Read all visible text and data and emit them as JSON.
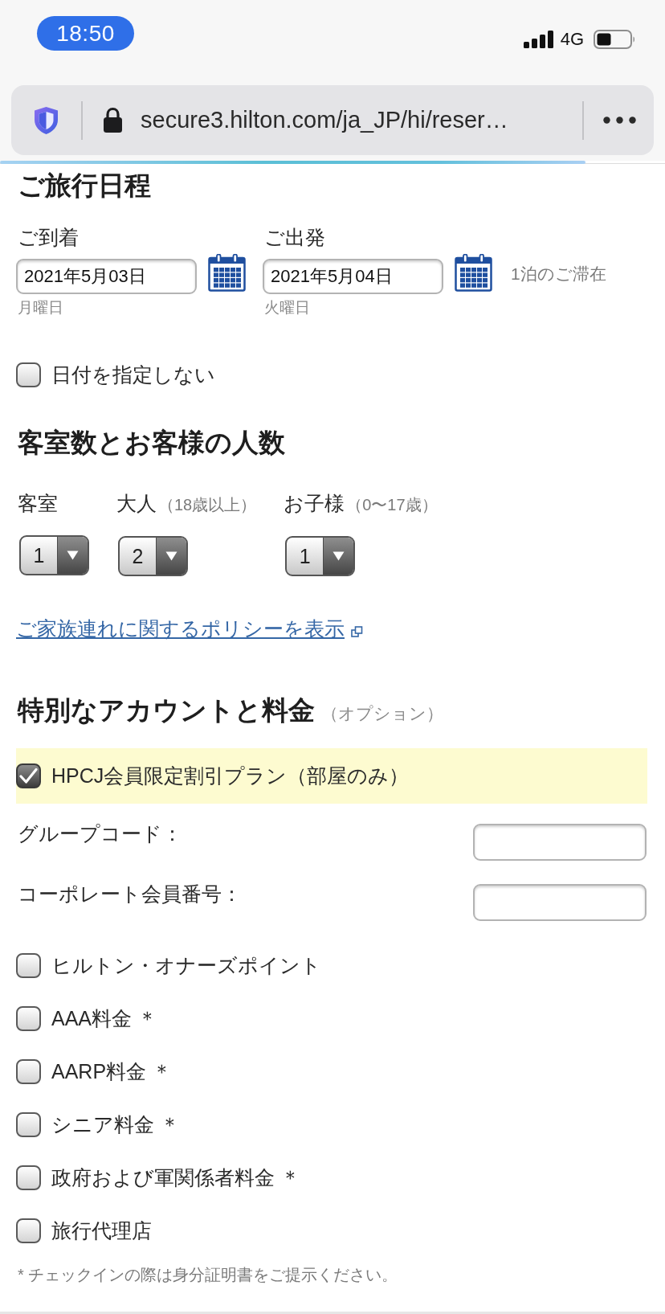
{
  "status_bar": {
    "time": "18:50",
    "network": "4G"
  },
  "browser": {
    "url": "secure3.hilton.com/ja_JP/hi/reser…",
    "load_progress": {
      "level": 0.88
    }
  },
  "itinerary": {
    "heading": "ご旅行日程",
    "dates": [
      {
        "label": "ご到着",
        "value": "2021年5月03日",
        "weekday": "月曜日"
      },
      {
        "label": "ご出発",
        "value": "2021年5月04日",
        "weekday": "火曜日"
      }
    ],
    "stay_length": "1泊のご滞在",
    "no_dates": {
      "label": "日付を指定しない",
      "checked": false
    }
  },
  "rooms_guests": {
    "heading": "客室数とお客様の人数",
    "selectors": [
      {
        "label": "客室",
        "value": "1"
      },
      {
        "label": "大人",
        "note": "（18歳以上）",
        "value": "2"
      },
      {
        "label": "お子様",
        "note": "（0〜17歳）",
        "value": "1"
      }
    ],
    "policy_link": "ご家族連れに関するポリシーを表示"
  },
  "special_rates": {
    "heading": "特別なアカウントと料金",
    "heading_note": "（オプション）",
    "plan": {
      "label": "HPCJ会員限定割引プラン（部屋のみ）",
      "checked": true
    },
    "code_fields": [
      {
        "label": "グループコード："
      },
      {
        "label": "コーポレート会員番号："
      }
    ],
    "options": [
      {
        "label": "ヒルトン・オナーズポイント",
        "checked": false
      },
      {
        "label": "AAA料金 ＊",
        "checked": false
      },
      {
        "label": "AARP料金 ＊",
        "checked": false
      },
      {
        "label": "シニア料金 ＊",
        "checked": false
      },
      {
        "label": "政府および軍関係者料金 ＊",
        "checked": false
      },
      {
        "label": "旅行代理店",
        "checked": false
      }
    ],
    "footnote": "* チェックインの際は身分証明書をご提示ください。"
  }
}
